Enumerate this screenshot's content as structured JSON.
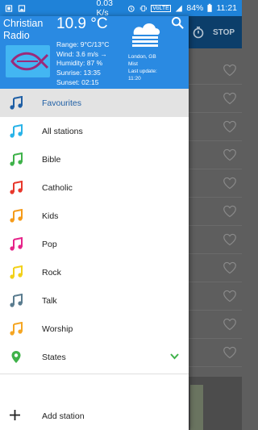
{
  "status_bar": {
    "speed": "0.03 K/s",
    "network": "VoLTE",
    "battery": "84%",
    "time": "11:21"
  },
  "header": {
    "app_title": "Christian Radio",
    "temperature": "10.9 °C",
    "range": "Range: 9°C/13°C",
    "wind": "Wind: 3.6 m/s →",
    "humidity": "Humidity: 87 %",
    "sunrise": "Sunrise: 13:35",
    "sunset": "Sunset: 02:15",
    "location": "London, GB",
    "condition": "Mist",
    "last_update_label": "Last update:",
    "last_update_time": "11:20",
    "weather_icon": "mist-cloud-icon",
    "search_icon": "search-icon"
  },
  "menu": {
    "items": [
      {
        "label": "Favourites",
        "color": "#1f5fa5"
      },
      {
        "label": "All stations",
        "color": "#29b3e8"
      },
      {
        "label": "Bible",
        "color": "#3fb24a"
      },
      {
        "label": "Catholic",
        "color": "#e8382c"
      },
      {
        "label": "Kids",
        "color": "#f59b1a"
      },
      {
        "label": "Pop",
        "color": "#e6248a"
      },
      {
        "label": "Rock",
        "color": "#f2d11a"
      },
      {
        "label": "Talk",
        "color": "#5a7c8f"
      },
      {
        "label": "Worship",
        "color": "#f5a623"
      }
    ],
    "states": {
      "label": "States",
      "color": "#3fb24a"
    },
    "add_station": "Add station"
  },
  "background_app": {
    "stop_label": "STOP"
  },
  "colors": {
    "accent": "#2a8ae2",
    "status_bar": "#1f82d8",
    "toolbar_dark": "#0c3e6a"
  }
}
